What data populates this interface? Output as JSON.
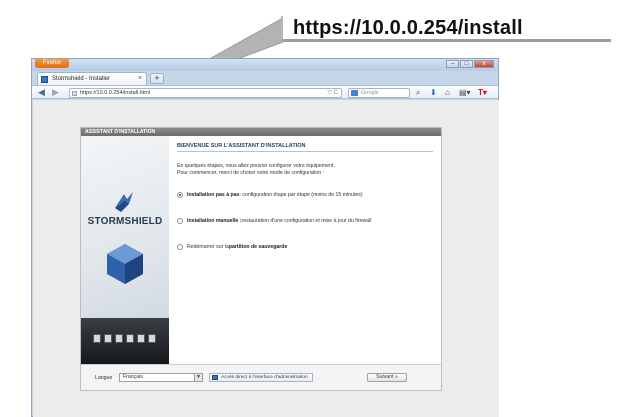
{
  "callout": {
    "url": "https://10.0.0.254/install"
  },
  "browser": {
    "firefox_button": "Firefox",
    "tab_title": "Stormshield - Installer",
    "new_tab": "+",
    "address": "https://10.0.0.254/install.html",
    "address_controls": "▽ C",
    "search_placeholder": "Google",
    "window_buttons": {
      "minimize": "–",
      "maximize": "□",
      "close": "x"
    },
    "nav": {
      "back": "◀",
      "forward": "▶"
    },
    "toolbar": {
      "search_go": "⌕",
      "download": "⬇",
      "home": "⌂",
      "menu": "▤▾",
      "addon": "T▾"
    }
  },
  "wizard": {
    "header": "ASSISTANT D'INSTALLATION",
    "brand": "STORMSHIELD",
    "title": "BIENVENUE SUR L'ASSISTANT D'INSTALLATION",
    "intro_line1": "En quelques étapes, vous allez pouvoir configurer votre équipement.",
    "intro_line2": "Pour commencer, merci de choisir votre mode de configuration :",
    "options": [
      {
        "label": "Installation pas à pas",
        "description": " : configuration étape par étape (moins de 15 minutes)",
        "selected": true
      },
      {
        "label": "Installation manuelle :",
        "description": " restauration d'une configuration et mise à jour du firewall",
        "selected": false
      },
      {
        "prefix": "Redémarrer sur la ",
        "label": "partition de sauvegarde",
        "selected": false
      }
    ],
    "footer": {
      "language_label": "Langue",
      "language_value": "Français",
      "admin_link": "Accès direct à l'interface d'administration",
      "next_button": "Suivant  »"
    }
  },
  "colors": {
    "accent": "#2a3f63",
    "window_frame": "#c7d7ea",
    "firefox": "#e06a10"
  }
}
